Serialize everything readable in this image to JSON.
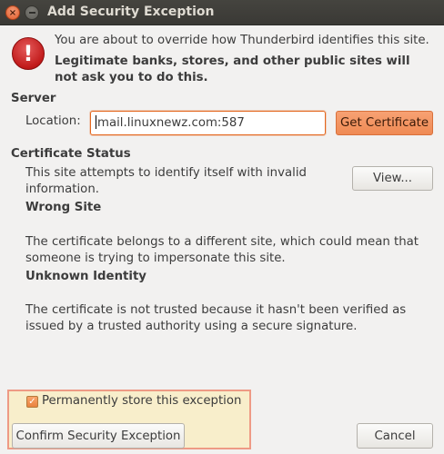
{
  "window": {
    "title": "Add Security Exception",
    "close_glyph": "×"
  },
  "warning": {
    "line1": "You are about to override how Thunderbird identifies this site.",
    "line2": "Legitimate banks, stores, and other public sites will not ask you to do this."
  },
  "server": {
    "heading": "Server",
    "location_label": "Location:",
    "location_value": "mail.linuxnewz.com:587",
    "get_certificate_label": "Get Certificate"
  },
  "status": {
    "heading": "Certificate Status",
    "summary": "This site attempts to identify itself with invalid information.",
    "view_label": "View...",
    "issues": [
      {
        "title": "Wrong Site",
        "description": "The certificate belongs to a different site, which could mean that someone is trying to impersonate this site."
      },
      {
        "title": "Unknown Identity",
        "description": "The certificate is not trusted because it hasn't been verified as issued by a trusted authority using a secure signature."
      }
    ]
  },
  "footer": {
    "permanent_label": "Permanently store this exception",
    "permanent_checked": true,
    "confirm_label": "Confirm Security Exception",
    "cancel_label": "Cancel"
  }
}
